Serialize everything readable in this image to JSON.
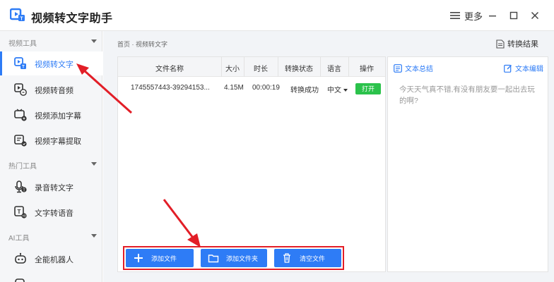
{
  "app": {
    "title": "视频转文字助手",
    "more_label": "更多"
  },
  "sidebar": {
    "groups": [
      {
        "label": "视频工具"
      },
      {
        "label": "热门工具"
      },
      {
        "label": "AI工具"
      }
    ],
    "items": [
      {
        "label": "视频转文字",
        "icon": "video-to-text-icon"
      },
      {
        "label": "视频转音频",
        "icon": "video-to-audio-icon"
      },
      {
        "label": "视频添加字幕",
        "icon": "add-subtitle-icon"
      },
      {
        "label": "视频字幕提取",
        "icon": "subtitle-extract-icon"
      },
      {
        "label": "录音转文字",
        "icon": "microphone-icon"
      },
      {
        "label": "文字转语音",
        "icon": "text-to-speech-icon"
      },
      {
        "label": "全能机器人",
        "icon": "robot-icon"
      }
    ]
  },
  "main": {
    "breadcrumb": "首页 · 视频转文字",
    "result_label": "转换结果",
    "table": {
      "headers": [
        "文件名称",
        "大小",
        "时长",
        "转换状态",
        "语言",
        "操作"
      ],
      "rows": [
        {
          "name": "1745557443-39294153...",
          "size": "4.15M",
          "duration": "00:00:19",
          "status": "转换成功",
          "language": "中文",
          "action": "打开"
        }
      ]
    },
    "toolbar": {
      "add_file": "添加文件",
      "add_folder": "添加文件夹",
      "clear": "清空文件"
    },
    "text_panel": {
      "summary_label": "文本总结",
      "edit_label": "文本编辑",
      "content": "今天天气真不错,有没有朋友要一起出去玩的啊?"
    }
  },
  "colors": {
    "accent": "#2e7cf6",
    "success": "#2bc24b",
    "annotation": "#e21e27"
  }
}
